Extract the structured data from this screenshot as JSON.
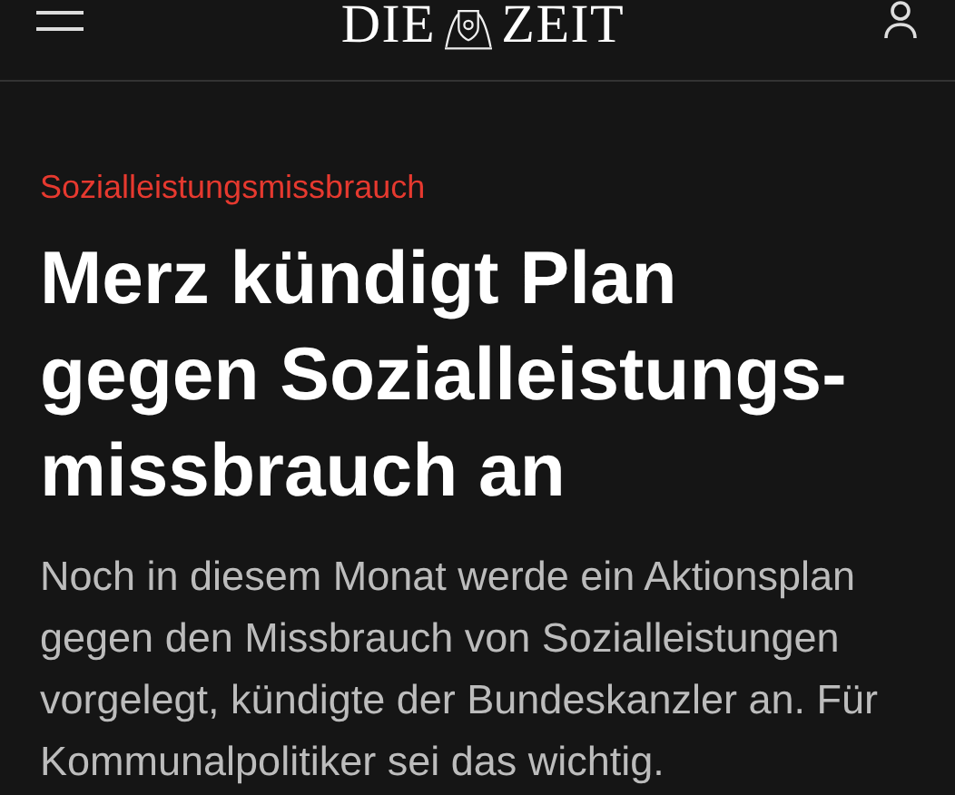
{
  "header": {
    "logo_left": "DIE",
    "logo_right": "ZEIT"
  },
  "article": {
    "kicker": "Sozialleistungsmissbrauch",
    "headline": "Merz kündigt Plan gegen Sozialleistungs-missbrauch an",
    "summary": "Noch in diesem Monat werde ein Aktionsplan gegen den Missbrauch von Sozialleistungen vorgelegt, kündigte der Bundeskanzler an. Für Kommunalpolitiker sei das wichtig."
  }
}
